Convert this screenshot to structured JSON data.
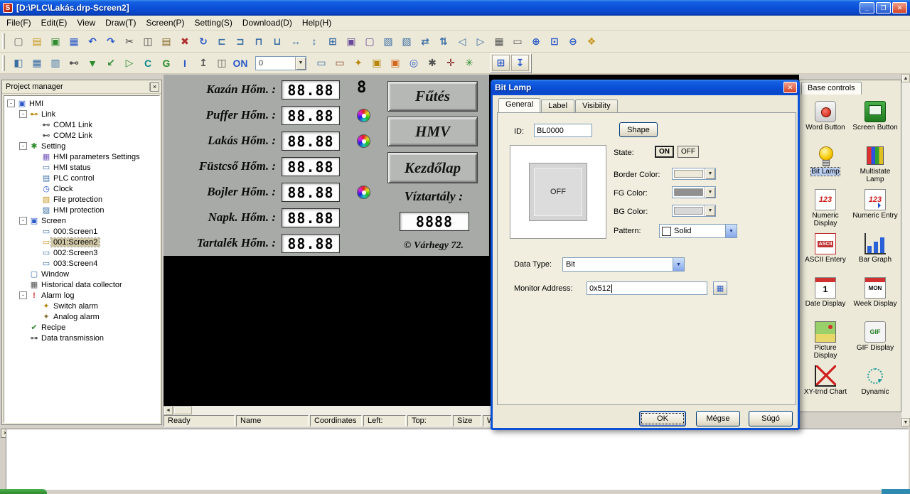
{
  "window": {
    "title": "[D:\\PLC\\Lakás.drp-Screen2]",
    "logo_text": "S",
    "minimize_glyph": "_",
    "restore_glyph": "❐",
    "close_glyph": "✕"
  },
  "glyphs": {
    "combo_arrow": "▼",
    "scroll_left": "◄",
    "scroll_right": "►",
    "scroll_up": "▲",
    "scroll_down": "▼"
  },
  "menu": {
    "items": [
      {
        "name": "menu-file",
        "label": "File(F)"
      },
      {
        "name": "menu-edit",
        "label": "Edit(E)"
      },
      {
        "name": "menu-view",
        "label": "View"
      },
      {
        "name": "menu-draw",
        "label": "Draw(T)"
      },
      {
        "name": "menu-screen",
        "label": "Screen(P)"
      },
      {
        "name": "menu-setting",
        "label": "Setting(S)"
      },
      {
        "name": "menu-download",
        "label": "Download(D)"
      },
      {
        "name": "menu-help",
        "label": "Help(H)"
      }
    ]
  },
  "toolbar1": {
    "icons": [
      {
        "name": "new-file-icon",
        "glyph": "▢",
        "color": "#666666"
      },
      {
        "name": "open-project-icon",
        "glyph": "▤",
        "color": "#c8961e"
      },
      {
        "name": "add-screen-icon",
        "glyph": "▣",
        "color": "#2e8b2e"
      },
      {
        "name": "save-icon",
        "glyph": "▦",
        "color": "#2a58c8"
      },
      {
        "name": "undo-icon",
        "glyph": "↶",
        "color": "#2a58c8"
      },
      {
        "name": "redo-icon",
        "glyph": "↷",
        "color": "#2a58c8"
      },
      {
        "name": "cut-icon",
        "glyph": "✂",
        "color": "#444444"
      },
      {
        "name": "copy-icon",
        "glyph": "◫",
        "color": "#444444"
      },
      {
        "name": "paste-icon",
        "glyph": "▤",
        "color": "#8a6b2f"
      },
      {
        "name": "delete-icon",
        "glyph": "✖",
        "color": "#b03030"
      },
      {
        "name": "rotate-icon",
        "glyph": "↻",
        "color": "#2a58c8"
      },
      {
        "name": "align-left-icon",
        "glyph": "⊏",
        "color": "#3a6ea5"
      },
      {
        "name": "align-right-icon",
        "glyph": "⊐",
        "color": "#3a6ea5"
      },
      {
        "name": "align-top-icon",
        "glyph": "⊓",
        "color": "#3a6ea5"
      },
      {
        "name": "align-bottom-icon",
        "glyph": "⊔",
        "color": "#3a6ea5"
      },
      {
        "name": "same-width-icon",
        "glyph": "↔",
        "color": "#3a6ea5"
      },
      {
        "name": "same-height-icon",
        "glyph": "↕",
        "color": "#3a6ea5"
      },
      {
        "name": "same-size-icon",
        "glyph": "⊞",
        "color": "#3a6ea5"
      },
      {
        "name": "group-icon",
        "glyph": "▣",
        "color": "#6a4a9a"
      },
      {
        "name": "ungroup-icon",
        "glyph": "▢",
        "color": "#6a4a9a"
      },
      {
        "name": "bring-front-icon",
        "glyph": "▧",
        "color": "#3a6ea5"
      },
      {
        "name": "send-back-icon",
        "glyph": "▨",
        "color": "#3a6ea5"
      },
      {
        "name": "space-horizontal-icon",
        "glyph": "⇄",
        "color": "#3a6ea5"
      },
      {
        "name": "space-vertical-icon",
        "glyph": "⇅",
        "color": "#3a6ea5"
      },
      {
        "name": "flip-horizontal-icon",
        "glyph": "◁",
        "color": "#3a6ea5"
      },
      {
        "name": "flip-vertical-icon",
        "glyph": "▷",
        "color": "#3a6ea5"
      },
      {
        "name": "grid-icon",
        "glyph": "▦",
        "color": "#555555"
      },
      {
        "name": "ruler-icon",
        "glyph": "▭",
        "color": "#555555"
      },
      {
        "name": "zoom-in-icon",
        "glyph": "⊕",
        "color": "#2a58c8"
      },
      {
        "name": "zoom-actual-icon",
        "glyph": "⊡",
        "color": "#2a58c8"
      },
      {
        "name": "zoom-out-icon",
        "glyph": "⊖",
        "color": "#2a58c8"
      },
      {
        "name": "pan-icon",
        "glyph": "❖",
        "color": "#c8961e"
      }
    ]
  },
  "toolbar2": {
    "combo_value": "0",
    "icons_left": [
      {
        "name": "screen-properties-icon",
        "glyph": "◧",
        "color": "#3a6ea5"
      },
      {
        "name": "tile-windows-icon",
        "glyph": "▦",
        "color": "#3a6ea5"
      },
      {
        "name": "cascade-windows-icon",
        "glyph": "▥",
        "color": "#3a6ea5"
      },
      {
        "name": "com-connect-icon",
        "glyph": "⊷",
        "color": "#555555"
      },
      {
        "name": "download-icon",
        "glyph": "▼",
        "color": "#2e8b2e"
      },
      {
        "name": "upload-icon",
        "glyph": "↙",
        "color": "#2e8b2e"
      },
      {
        "name": "export-icon",
        "glyph": "▷",
        "color": "#2e8b2e"
      },
      {
        "name": "compile-icon",
        "glyph": "C",
        "color": "#0a8a8a"
      },
      {
        "name": "build-icon",
        "glyph": "G",
        "color": "#2e8b2e"
      },
      {
        "name": "info-icon",
        "glyph": "I",
        "color": "#2a58c8"
      },
      {
        "name": "page-up-icon",
        "glyph": "↥",
        "color": "#555555"
      },
      {
        "name": "page-list-icon",
        "glyph": "◫",
        "color": "#555555"
      },
      {
        "name": "simulate-icon",
        "glyph": "ON",
        "color": "#2a58c8"
      }
    ],
    "icons_right": [
      {
        "name": "monitor-icon",
        "glyph": "▭",
        "color": "#3a6ea5"
      },
      {
        "name": "offline-simulation-icon",
        "glyph": "▭",
        "color": "#8a4a2a"
      },
      {
        "name": "password-icon",
        "glyph": "✦",
        "color": "#b8860b"
      },
      {
        "name": "lock-icon",
        "glyph": "▣",
        "color": "#b8860b"
      },
      {
        "name": "unlock-icon",
        "glyph": "▣",
        "color": "#d2691e"
      },
      {
        "name": "find-icon",
        "glyph": "◎",
        "color": "#2a58c8"
      },
      {
        "name": "system-settings-icon",
        "glyph": "✱",
        "color": "#555555"
      },
      {
        "name": "tools-icon",
        "glyph": "✛",
        "color": "#8a2a2a"
      },
      {
        "name": "percent-icon",
        "glyph": "✳",
        "color": "#2e8b2e"
      }
    ],
    "special": [
      {
        "name": "grid-editor-icon",
        "glyph": "⊞",
        "color": "#2a58c8"
      },
      {
        "name": "download-board-icon",
        "glyph": "↧",
        "color": "#2a58c8"
      }
    ]
  },
  "project_manager": {
    "title": "Project manager",
    "close_glyph": "×",
    "tree": [
      {
        "label": "HMI",
        "glyph": "▣",
        "exp": "-"
      },
      {
        "label": "Link",
        "glyph": "⊷",
        "exp": "-"
      },
      {
        "label": "COM1 Link",
        "glyph": "⊷"
      },
      {
        "label": "COM2 Link",
        "glyph": "⊷"
      },
      {
        "label": "Setting",
        "glyph": "✱",
        "exp": "-"
      },
      {
        "label": "HMI parameters Settings",
        "glyph": "▦"
      },
      {
        "label": "HMI status",
        "glyph": "▭"
      },
      {
        "label": "PLC control",
        "glyph": "▤"
      },
      {
        "label": "Clock",
        "glyph": "◷"
      },
      {
        "label": "File protection",
        "glyph": "▧"
      },
      {
        "label": "HMI protection",
        "glyph": "▨"
      },
      {
        "label": "Screen",
        "glyph": "▣",
        "exp": "-"
      },
      {
        "label": "000:Screen1",
        "glyph": "▭"
      },
      {
        "label": "001:Screen2",
        "glyph": "▭"
      },
      {
        "label": "002:Screen3",
        "glyph": "▭"
      },
      {
        "label": "003:Screen4",
        "glyph": "▭"
      },
      {
        "label": "Window",
        "glyph": "▢"
      },
      {
        "label": "Historical data collector",
        "glyph": "▦"
      },
      {
        "label": "Alarm log",
        "glyph": "!",
        "exp": "-"
      },
      {
        "label": "Switch alarm",
        "glyph": "✦"
      },
      {
        "label": "Analog alarm",
        "glyph": "✦"
      },
      {
        "label": "Recipe",
        "glyph": "✔"
      },
      {
        "label": "Data transmission",
        "glyph": "⊶"
      }
    ]
  },
  "hmi_screen": {
    "bit_lamp_glyph": "8",
    "rows": [
      {
        "label": "Kazán Hőm. :",
        "value": "88.88"
      },
      {
        "label": "Puffer Hőm. :",
        "value": "88.88"
      },
      {
        "label": "Lakás Hőm. :",
        "value": "88.88"
      },
      {
        "label": "Füstcső Hőm. :",
        "value": "88.88"
      },
      {
        "label": "Bojler Hőm. :",
        "value": "88.88"
      },
      {
        "label": "Napk. Hőm. :",
        "value": "88.88"
      },
      {
        "label": "Tartalék Hőm. :",
        "value": "88.88"
      }
    ],
    "buttons": [
      {
        "name": "futes-button",
        "label": "Fűtés"
      },
      {
        "name": "hmv-button",
        "label": "HMV"
      },
      {
        "name": "kezdolap-button",
        "label": "Kezdőlap"
      }
    ],
    "tank_label": "Víztartály :",
    "tank_value": "8888",
    "copyright": "© Várhegy 72."
  },
  "dialog": {
    "title": "Bit Lamp",
    "close_glyph": "✕",
    "tabs": [
      {
        "name": "tab-general",
        "label": "General"
      },
      {
        "name": "tab-label",
        "label": "Label"
      },
      {
        "name": "tab-visibility",
        "label": "Visibility"
      }
    ],
    "id_label": "ID:",
    "id_value": "BL0000",
    "shape_button": "Shape",
    "preview_text": "OFF",
    "state_label": "State:",
    "on_label": "ON",
    "off_label": "OFF",
    "border_color_label": "Border Color:",
    "fg_color_label": "FG Color:",
    "bg_color_label": "BG Color:",
    "pattern_label": "Pattern:",
    "pattern_value": "Solid",
    "data_type_label": "Data Type:",
    "data_type_value": "Bit",
    "monitor_label": "Monitor Address:",
    "monitor_value": "0x512",
    "ok": "OK",
    "cancel": "Mégse",
    "help": "Súgó",
    "colors": {
      "fg_well": "#909090",
      "border_well": "#ece9d8",
      "bg_well": "#d8d8d8"
    }
  },
  "base_controls": {
    "title": "Base controls",
    "items": [
      {
        "label": "Word Button"
      },
      {
        "label": "Screen Button"
      },
      {
        "label": "Bit Lamp"
      },
      {
        "label": "Multistate Lamp"
      },
      {
        "label": "Numeric Display",
        "icon_text": "123"
      },
      {
        "label": "Numeric Entry",
        "icon_text": "123"
      },
      {
        "label": "ASCII Entery",
        "icon_text": "ASCII"
      },
      {
        "label": "Bar Graph"
      },
      {
        "label": "Date Display",
        "icon_text": "1"
      },
      {
        "label": "Week Display",
        "icon_text": "MON"
      },
      {
        "label": "Picture Display"
      },
      {
        "label": "GIF Display",
        "icon_text": "GIF"
      },
      {
        "label": "XY-trnd Chart"
      },
      {
        "label": "Dynamic"
      }
    ]
  },
  "status_bar": {
    "cells": [
      "Ready",
      "Name",
      "Coordinates",
      "Left:",
      "Top:",
      "Size",
      "Width"
    ]
  },
  "output_panel": {
    "close_glyph": "×"
  }
}
